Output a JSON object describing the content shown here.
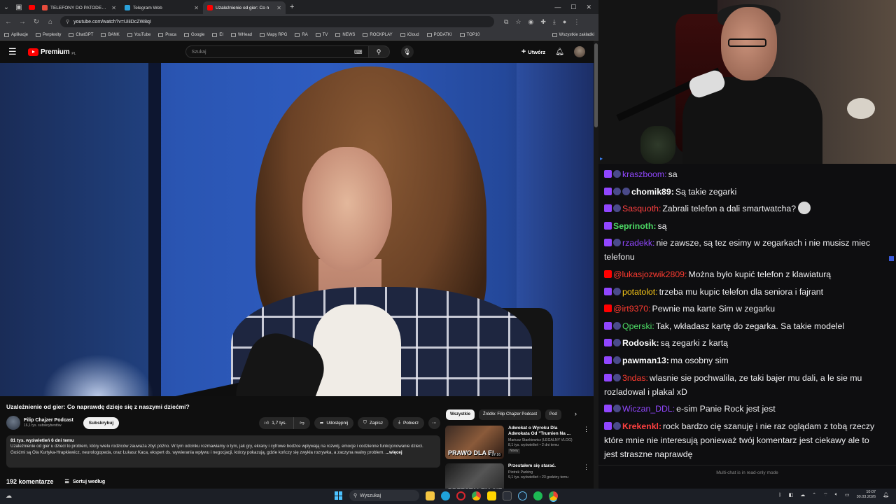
{
  "tabs": [
    {
      "title": "TELEFONY DO PATODEWELOPI",
      "favicon_color": "#e74c3c",
      "active": false
    },
    {
      "title": "Telegram Web",
      "favicon_color": "#2aa1da",
      "active": false
    },
    {
      "title": "Uzależnienie od gier: Co n",
      "favicon_color": "#ff0000",
      "active": true
    }
  ],
  "address": {
    "url": "youtube.com/watch?v=UiiiDcZW8qI"
  },
  "bookmarks": [
    "Aplikacje",
    "Perplexity",
    "ChatGPT",
    "BANK",
    "YouTube",
    "Praca",
    "Google",
    "EI",
    "WHead",
    "Mapy RPG",
    "RA",
    "TV",
    "NEWS",
    "ROCKPLAY",
    "iCloud",
    "PODATKI",
    "TOP10"
  ],
  "bookmarks_all": "Wszystkie zakładki",
  "yt": {
    "logo": "Premium",
    "logo_suffix": "PL",
    "search_placeholder": "Szukaj",
    "create_label": "Utwórz"
  },
  "video": {
    "title": "Uzależnienie od gier: Co naprawdę dzieje się z naszymi dziećmi?",
    "channel": "Filip Chajzer Podcast",
    "subscribers": "16,1 tys. subskrybentów",
    "subscribe_label": "Subskrybuj",
    "likes": "1,7 tys.",
    "share_label": "Udostępnij",
    "save_label": "Zapisz",
    "download_label": "Pobierz",
    "desc_meta": "81 tys. wyświetleń  6 dni temu",
    "desc_text": "Uzależnienie od gier u dzieci to problem, który wielu rodziców zauważa zbyt późno. W tym odcinku rozmawiamy o tym, jak gry, ekrany i cyfrowe bodźce wpływają na rozwój, emocje i codzienne funkcjonowanie dzieci. Gośćmi są Ola Kurtyka-Hrapkiewicz, neurologopeda, oraz Łukasz Kaca, ekspert ds. wywierania wpływu i negocjacji, którzy pokazują, gdzie kończy się zwykła rozrywka, a zaczyna realny problem.",
    "desc_more": "...więcej",
    "comments_count": "192 komentarze",
    "sort_label": "Sortuj według"
  },
  "chips": [
    "Wszystkie",
    "Źródło: Filip Chajzer Podcast",
    "Pod"
  ],
  "recommendations": [
    {
      "title": "Adwokat o Wyroku Dla Adwokata Od \"Trumien Na ...",
      "channel": "Mariusz Stankiewicz (LEGALNY VLOG)",
      "stats": "8,1 tys. wyświetleń • 2 dni temu",
      "badge": "Nowy",
      "duration": "27:16",
      "thumb_text": "PRAWO DLA EL"
    },
    {
      "title": "Przestałem się starać.",
      "channel": "Piotrek Parking",
      "stats": "9,1 tys. wyświetleń • 23 godziny temu",
      "badge": "",
      "duration": "",
      "thumb_text": "PRZESTAŁEM SIĘ"
    }
  ],
  "chat": {
    "messages": [
      {
        "user": "kraszboom:",
        "color": "#9147ff",
        "bold": false,
        "text": "sa",
        "badges": [
          "twitch",
          "emo"
        ],
        "emote": false
      },
      {
        "user": "chomik89:",
        "color": "#ffffff",
        "bold": true,
        "text": "Są takie zegarki",
        "badges": [
          "twitch",
          "emo",
          "emo"
        ],
        "emote": false
      },
      {
        "user": "Sasquoth:",
        "color": "#ff4040",
        "bold": false,
        "text": "Zabrali telefon a dali smartwatcha?",
        "badges": [
          "twitch",
          "emo"
        ],
        "emote": true
      },
      {
        "user": "Seprinoth:",
        "color": "#4cd964",
        "bold": true,
        "text": "są",
        "badges": [
          "twitch"
        ],
        "emote": false
      },
      {
        "user": "rzadekk:",
        "color": "#9147ff",
        "bold": false,
        "text": "nie zawsze, są tez esimy w zegarkach i nie musisz miec telefonu",
        "badges": [
          "twitch",
          "emo"
        ],
        "emote": false
      },
      {
        "user": "@lukasjozwik2809:",
        "color": "#ff3b30",
        "bold": false,
        "text": "Można było kupić telefon z klawiaturą",
        "badges": [
          "yt"
        ],
        "emote": false
      },
      {
        "user": "potatolot:",
        "color": "#f5c518",
        "bold": false,
        "text": "trzeba mu kupic telefon dla seniora i fajrant",
        "badges": [
          "twitch",
          "emo"
        ],
        "emote": false
      },
      {
        "user": "@irt9370:",
        "color": "#ff3b30",
        "bold": false,
        "text": "Pewnie ma karte Sim w zegarku",
        "badges": [
          "yt"
        ],
        "emote": false
      },
      {
        "user": "Qperski:",
        "color": "#4cd964",
        "bold": false,
        "text": "Tak, wkładasz kartę do zegarka. Sa takie modelel",
        "badges": [
          "twitch",
          "emo"
        ],
        "emote": false
      },
      {
        "user": "Rodosik:",
        "color": "#ffffff",
        "bold": true,
        "text": "są zegarki z kartą",
        "badges": [
          "twitch",
          "emo"
        ],
        "emote": false
      },
      {
        "user": "pawman13:",
        "color": "#ffffff",
        "bold": true,
        "text": "ma osobny sim",
        "badges": [
          "twitch",
          "emo"
        ],
        "emote": false
      },
      {
        "user": "3ndas:",
        "color": "#ff3b30",
        "bold": false,
        "text": "wlasnie sie pochwalila, ze taki bajer mu dali, a le sie mu rozladowal i plakal xD",
        "badges": [
          "twitch",
          "emo"
        ],
        "emote": false
      },
      {
        "user": "Wiczan_DDL:",
        "color": "#9147ff",
        "bold": false,
        "text": "e-sim Panie Rock jest jest",
        "badges": [
          "twitch",
          "emo"
        ],
        "emote": false
      },
      {
        "user": "Krekenkl:",
        "color": "#ff4040",
        "bold": true,
        "text": "rock bardzo cię szanuję i nie raz oglądam z tobą rzeczy które mnie nie interesują ponieważ twój komentarz jest ciekawy ale to jest straszne naprawdę",
        "badges": [
          "twitch",
          "emo"
        ],
        "emote": false
      }
    ],
    "footer": "Multi-chat is in read-only mode"
  },
  "taskbar": {
    "search_placeholder": "Wyszukaj",
    "time": "10:07",
    "date": "30.03.2026"
  }
}
